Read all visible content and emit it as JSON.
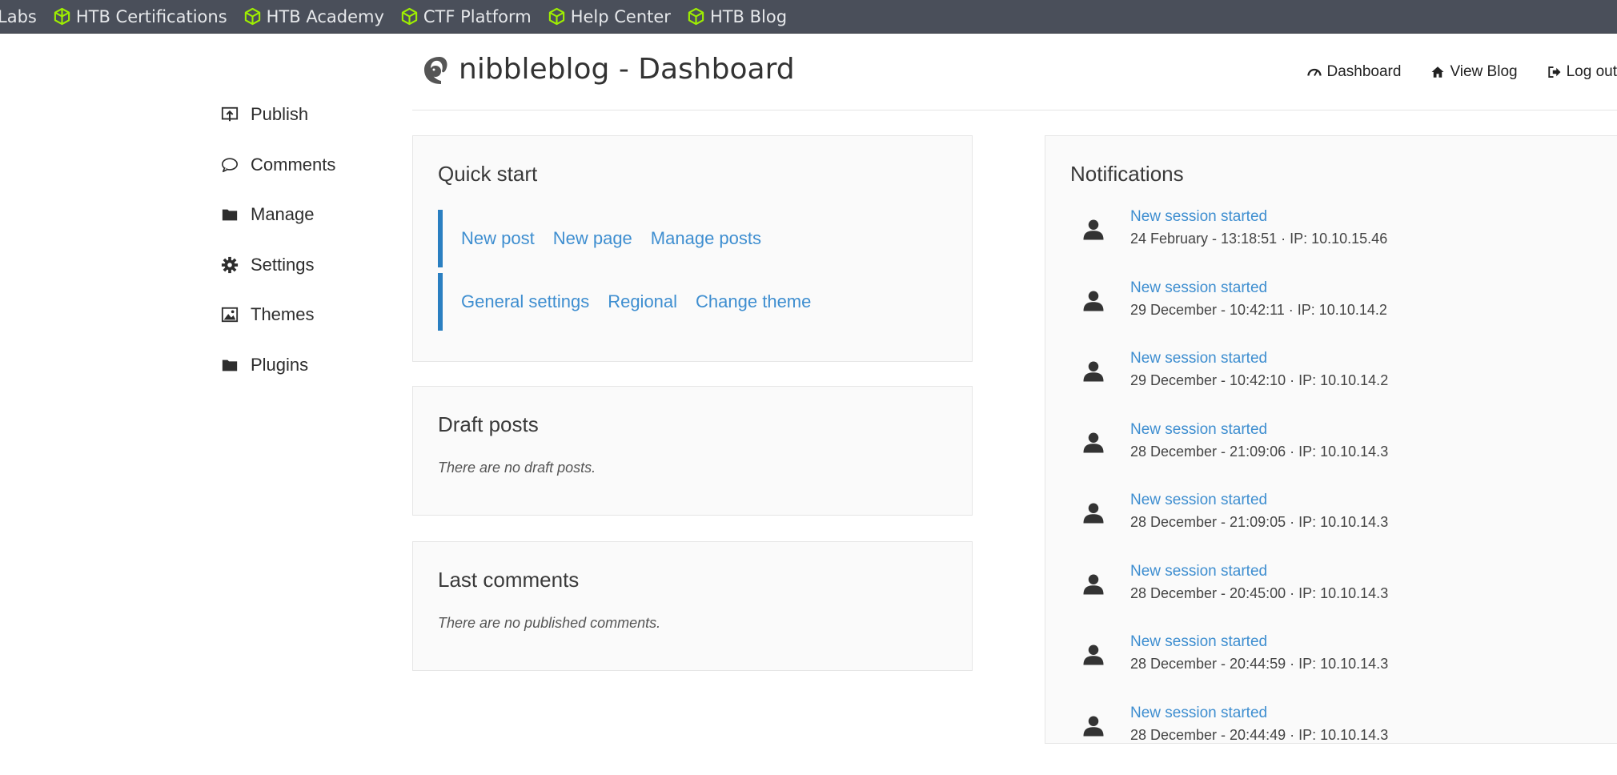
{
  "bookmarks": [
    {
      "label": "Labs",
      "icon": "none"
    },
    {
      "label": "HTB Certifications",
      "icon": "htb-cube-icon"
    },
    {
      "label": "HTB Academy",
      "icon": "htb-cube-icon"
    },
    {
      "label": "CTF Platform",
      "icon": "htb-cube-icon"
    },
    {
      "label": "Help Center",
      "icon": "htb-cube-icon"
    },
    {
      "label": "HTB Blog",
      "icon": "htb-cube-icon"
    }
  ],
  "header": {
    "title": "nibbleblog - Dashboard",
    "nav": [
      {
        "label": "Dashboard",
        "icon": "dashboard-gauge-icon"
      },
      {
        "label": "View Blog",
        "icon": "home-icon"
      },
      {
        "label": "Log out",
        "icon": "logout-icon"
      }
    ]
  },
  "sidebar": {
    "items": [
      {
        "label": "Publish",
        "icon": "publish-icon"
      },
      {
        "label": "Comments",
        "icon": "comment-icon"
      },
      {
        "label": "Manage",
        "icon": "folder-icon"
      },
      {
        "label": "Settings",
        "icon": "gear-icon"
      },
      {
        "label": "Themes",
        "icon": "image-icon"
      },
      {
        "label": "Plugins",
        "icon": "folder-icon"
      }
    ]
  },
  "quick_start": {
    "title": "Quick start",
    "row1": [
      "New post",
      "New page",
      "Manage posts"
    ],
    "row2": [
      "General settings",
      "Regional",
      "Change theme"
    ]
  },
  "draft_posts": {
    "title": "Draft posts",
    "empty": "There are no draft posts."
  },
  "last_comments": {
    "title": "Last comments",
    "empty": "There are no published comments."
  },
  "notifications": {
    "title": "Notifications",
    "items": [
      {
        "title": "New session started",
        "meta": "24 February - 13:18:51 · IP: 10.10.15.46"
      },
      {
        "title": "New session started",
        "meta": "29 December - 10:42:11 · IP: 10.10.14.2"
      },
      {
        "title": "New session started",
        "meta": "29 December - 10:42:10 · IP: 10.10.14.2"
      },
      {
        "title": "New session started",
        "meta": "28 December - 21:09:06 · IP: 10.10.14.3"
      },
      {
        "title": "New session started",
        "meta": "28 December - 21:09:05 · IP: 10.10.14.3"
      },
      {
        "title": "New session started",
        "meta": "28 December - 20:45:00 · IP: 10.10.14.3"
      },
      {
        "title": "New session started",
        "meta": "28 December - 20:44:59 · IP: 10.10.14.3"
      },
      {
        "title": "New session started",
        "meta": "28 December - 20:44:49 · IP: 10.10.14.3"
      }
    ]
  },
  "colors": {
    "bookmark_bar": "#4a4f5a",
    "htb_green": "#9fef00",
    "link_blue": "#3e8ed0",
    "accent_bar": "#2a7fc1"
  }
}
